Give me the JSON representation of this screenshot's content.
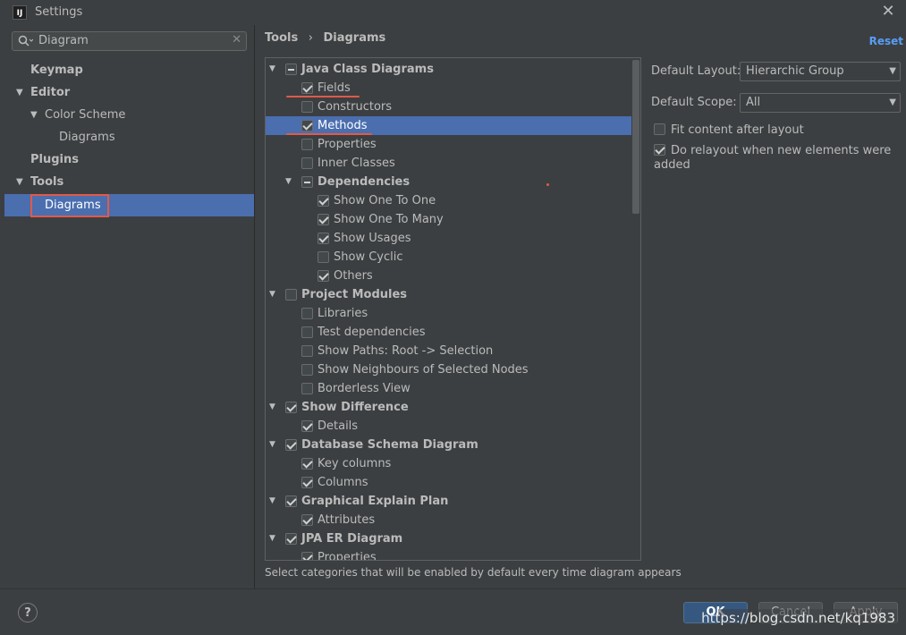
{
  "window": {
    "title": "Settings",
    "app_icon_text": "IJ"
  },
  "search": {
    "value": "Diagram"
  },
  "sidebar": {
    "items": [
      {
        "label": "Keymap",
        "bold": true
      },
      {
        "label": "Editor",
        "bold": true
      },
      {
        "label": "Color Scheme"
      },
      {
        "label": "Diagrams"
      },
      {
        "label": "Plugins",
        "bold": true
      },
      {
        "label": "Tools",
        "bold": true
      },
      {
        "label": "Diagrams",
        "selected": true
      }
    ]
  },
  "breadcrumb": {
    "parent": "Tools",
    "separator": "›",
    "current": "Diagrams"
  },
  "reset_label": "Reset",
  "categories": {
    "java_class": {
      "label": "Java Class Diagrams",
      "items": {
        "fields": "Fields",
        "constructors": "Constructors",
        "methods": "Methods",
        "properties": "Properties",
        "inner_classes": "Inner Classes"
      }
    },
    "dependencies": {
      "label": "Dependencies",
      "items": {
        "one_to_one": "Show One To One",
        "one_to_many": "Show One To Many",
        "usages": "Show Usages",
        "cyclic": "Show Cyclic",
        "others": "Others"
      }
    },
    "project_modules": {
      "label": "Project Modules",
      "items": {
        "libraries": "Libraries",
        "test_deps": "Test dependencies",
        "paths": "Show Paths: Root -> Selection",
        "neighbours": "Show Neighbours of Selected Nodes",
        "borderless": "Borderless View"
      }
    },
    "show_difference": {
      "label": "Show Difference",
      "items": {
        "details": "Details"
      }
    },
    "db_schema": {
      "label": "Database Schema Diagram",
      "items": {
        "key_columns": "Key columns",
        "columns": "Columns"
      }
    },
    "explain_plan": {
      "label": "Graphical Explain Plan",
      "items": {
        "attributes": "Attributes"
      }
    },
    "jpa_er": {
      "label": "JPA ER Diagram",
      "items": {
        "properties": "Properties"
      }
    }
  },
  "description": "Select categories that will be enabled by default every time diagram appears",
  "layout": {
    "label": "Default Layout:",
    "value": "Hierarchic Group"
  },
  "scope": {
    "label": "Default Scope:",
    "value": "All"
  },
  "options": {
    "fit_content": "Fit content after layout",
    "relayout": "Do relayout when new elements were added"
  },
  "buttons": {
    "ok": "OK",
    "cancel": "Cancel",
    "apply": "Apply",
    "help": "?"
  },
  "watermark": "https://blog.csdn.net/kq1983",
  "colors": {
    "selection": "#4b6eaf",
    "link": "#589df6",
    "annotation": "#e05a4a",
    "background": "#3c3f41"
  },
  "icons": [
    "search-icon",
    "clear-icon",
    "close-icon",
    "chevron-down-icon",
    "help-icon"
  ]
}
